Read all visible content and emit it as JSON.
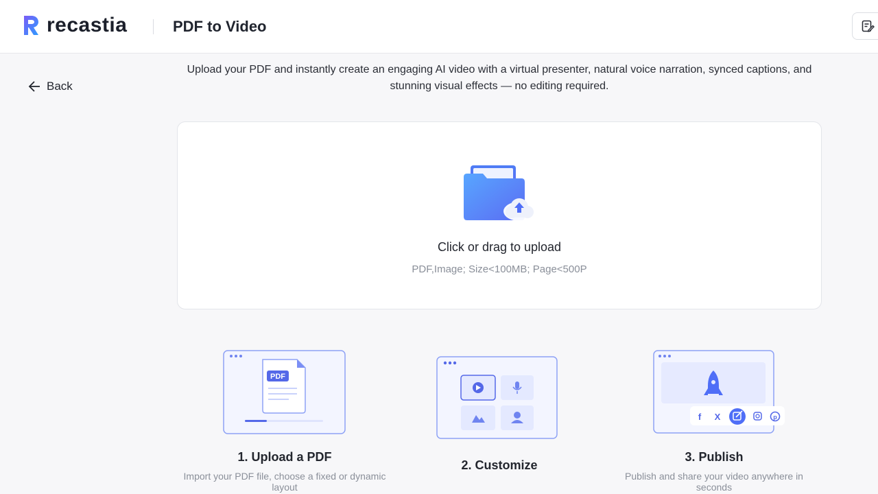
{
  "header": {
    "logo_text": "recastia",
    "page_title": "PDF to Video"
  },
  "nav": {
    "back_label": "Back"
  },
  "intro": {
    "text": "Upload your PDF and instantly create an engaging AI video with a virtual presenter, natural voice narration, synced captions, and stunning visual effects — no editing required."
  },
  "upload": {
    "title": "Click or drag to upload",
    "hint": "PDF,Image; Size<100MB; Page<500P",
    "pdf_badge": "PDF"
  },
  "steps": [
    {
      "label": "1. Upload a PDF",
      "description": "Import your PDF file, choose a fixed or dynamic layout"
    },
    {
      "label": "2. Customize",
      "description": ""
    },
    {
      "label": "3. Publish",
      "description": "Publish and share your video anywhere in seconds"
    }
  ],
  "icons": {
    "back": "arrow-left-icon",
    "note": "edit-note-icon",
    "upload": "folder-upload-icon",
    "social": [
      "facebook-icon",
      "x-icon",
      "share-icon",
      "instagram-icon",
      "pinterest-icon"
    ]
  },
  "colors": {
    "brand_blue": "#4f6ef7",
    "brand_purple": "#6a5cf6",
    "accent_light": "#e8ecff"
  }
}
